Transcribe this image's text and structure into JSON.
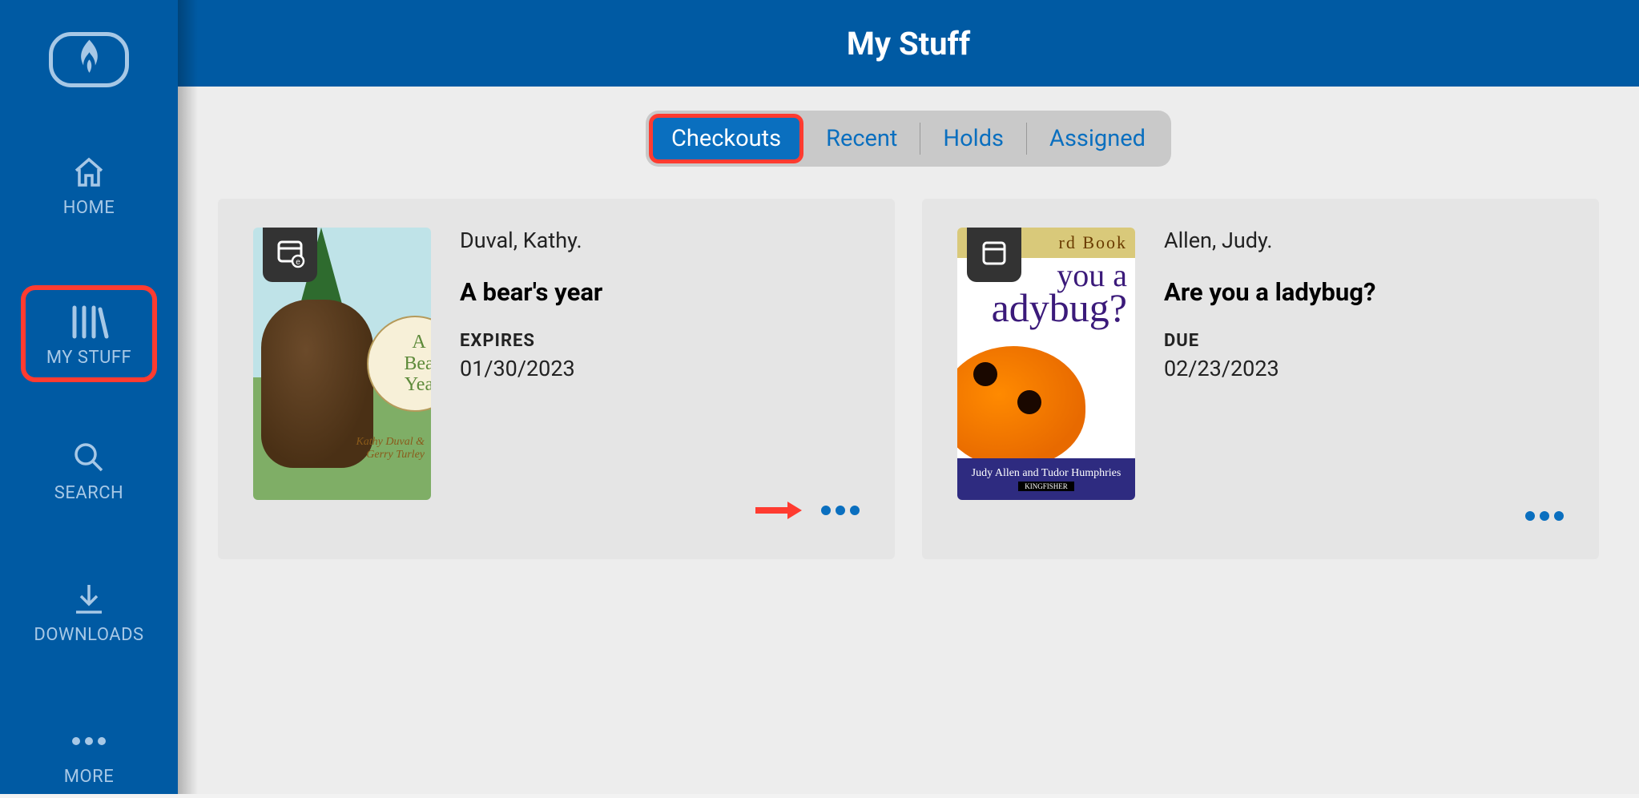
{
  "header": {
    "title": "My Stuff"
  },
  "sidebar": {
    "items": [
      {
        "label": "HOME"
      },
      {
        "label": "MY STUFF"
      },
      {
        "label": "SEARCH"
      },
      {
        "label": "DOWNLOADS"
      },
      {
        "label": "MORE"
      }
    ]
  },
  "tabs": {
    "items": [
      {
        "label": "Checkouts"
      },
      {
        "label": "Recent"
      },
      {
        "label": "Holds"
      },
      {
        "label": "Assigned"
      }
    ],
    "active_index": 0
  },
  "checkouts": [
    {
      "author": "Duval, Kathy.",
      "title": "A bear's year",
      "status_label": "EXPIRES",
      "status_date": "01/30/2023",
      "format": "ebook",
      "highlight_more": true,
      "cover": {
        "circle_line1": "A",
        "circle_line2": "Bea",
        "circle_line3": "Yea",
        "credits_line1": "Kathy Duval &",
        "credits_line2": "Gerry Turley"
      }
    },
    {
      "author": "Allen, Judy.",
      "title": "Are you a ladybug?",
      "status_label": "DUE",
      "status_date": "02/23/2023",
      "format": "book",
      "highlight_more": false,
      "cover": {
        "top_text": "rd Book",
        "qtext_line1": "you a",
        "qtext_line2": "adybug?",
        "credits": "Judy Allen and Tudor Humphries",
        "publisher": "KINGFISHER"
      }
    }
  ],
  "colors": {
    "brand": "#005aa3",
    "accent": "#0a6fbf",
    "highlight": "#ff3b30"
  }
}
